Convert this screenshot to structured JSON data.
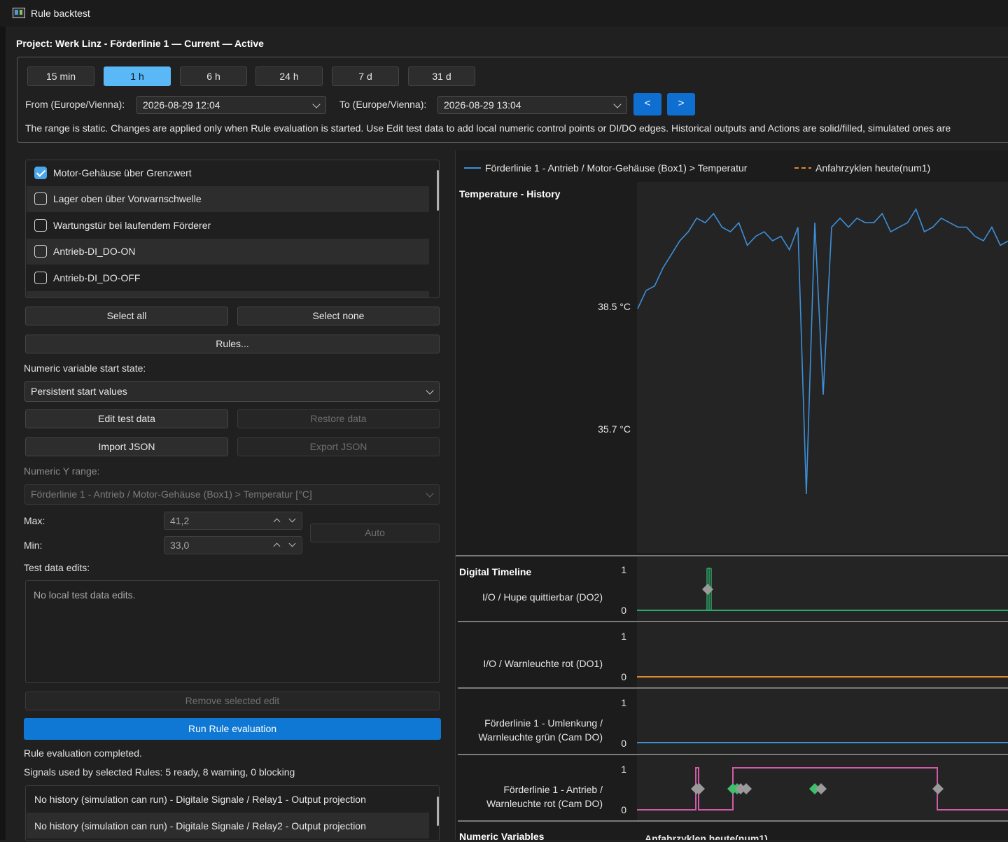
{
  "window": {
    "title": "Rule backtest"
  },
  "project": {
    "title": "Project: Werk Linz - Förderlinie 1 — Current — Active"
  },
  "range": {
    "presets": [
      "15 min",
      "1 h",
      "6 h",
      "24 h",
      "7 d",
      "31 d"
    ],
    "active_preset": "1 h",
    "from_label": "From (Europe/Vienna):",
    "from_value": "2026-08-29 12:04",
    "to_label": "To (Europe/Vienna):",
    "to_value": "2026-08-29 13:04",
    "prev_label": "<",
    "next_label": ">",
    "info": "The range is static. Changes are applied only when Rule evaluation is started. Use Edit test data to add local numeric control points or DI/DO edges. Historical outputs and Actions are solid/filled, simulated ones are"
  },
  "rules": {
    "items": [
      {
        "label": "Motor-Gehäuse über Grenzwert",
        "checked": true
      },
      {
        "label": "Lager oben über Vorwarnschwelle",
        "checked": false
      },
      {
        "label": "Wartungstür bei laufendem Förderer",
        "checked": false
      },
      {
        "label": "Antrieb-DI_DO-ON",
        "checked": false
      },
      {
        "label": "Antrieb-DI_DO-OFF",
        "checked": false
      }
    ],
    "select_all": "Select all",
    "select_none": "Select none",
    "rules_button": "Rules..."
  },
  "numeric_start": {
    "label": "Numeric variable start state:",
    "value": "Persistent start values"
  },
  "test_data": {
    "edit": "Edit test data",
    "restore": "Restore data",
    "import": "Import JSON",
    "export": "Export JSON"
  },
  "y_range": {
    "label": "Numeric Y range:",
    "variable": "Förderlinie 1 - Antrieb / Motor-Gehäuse (Box1) > Temperatur [°C]",
    "max_label": "Max:",
    "max_value": "41,2",
    "min_label": "Min:",
    "min_value": "33,0",
    "auto": "Auto"
  },
  "edits": {
    "label": "Test data edits:",
    "empty": "No local test data edits.",
    "remove": "Remove selected edit"
  },
  "run": {
    "button": "Run Rule evaluation",
    "status": "Rule evaluation completed.",
    "signals_summary": "Signals used by selected Rules: 5 ready, 8 warning, 0 blocking"
  },
  "signals": {
    "items": [
      "No history (simulation can run) - Digitale Signale / Relay1 - Output projection",
      "No history (simulation can run) - Digitale Signale / Relay2 - Output projection"
    ]
  },
  "chart_data": {
    "type": "line",
    "legend": [
      {
        "name": "Förderlinie 1 - Antrieb / Motor-Gehäuse (Box1) > Temperatur",
        "style": "solid",
        "color": "#3d8fd9"
      },
      {
        "name": "Anfahrzyklen heute(num1)",
        "style": "dashed",
        "color": "#e08a2a"
      }
    ],
    "title": "Temperature - History",
    "y_ticks": [
      "38.5 °C",
      "35.7 °C"
    ],
    "ylim": [
      33.0,
      41.2
    ],
    "temperature_series": [
      38.4,
      38.8,
      38.9,
      39.3,
      39.6,
      39.9,
      40.1,
      40.4,
      40.3,
      40.5,
      40.2,
      40.1,
      40.3,
      39.8,
      40.0,
      40.1,
      39.9,
      40.0,
      39.7,
      40.2,
      34.3,
      40.3,
      36.5,
      40.2,
      40.4,
      40.2,
      40.4,
      40.3,
      40.3,
      40.5,
      40.1,
      40.2,
      40.3,
      40.6,
      40.1,
      40.2,
      40.4,
      40.3,
      40.2,
      40.2,
      40.0,
      39.9,
      40.2,
      39.8,
      39.9
    ],
    "digital_title": "Digital Timeline",
    "digital_tracks": [
      {
        "label_lines": [
          "I/O / Hupe quittierbar (DO2)"
        ],
        "high": "1",
        "low": "0",
        "color": "#2ea86a"
      },
      {
        "label_lines": [
          "I/O / Warnleuchte rot (DO1)"
        ],
        "high": "1",
        "low": "0",
        "color": "#e08a2a"
      },
      {
        "label_lines": [
          "Förderlinie 1 - Umlenkung /",
          "Warnleuchte grün (Cam DO)"
        ],
        "high": "1",
        "low": "0",
        "color": "#3d8fd9"
      },
      {
        "label_lines": [
          "Förderlinie 1 - Antrieb /",
          "Warnleuchte rot (Cam DO)"
        ],
        "high": "1",
        "low": "0",
        "color": "#d25aa8"
      }
    ],
    "numeric_title": "Numeric Variables",
    "numeric_subtitle": "Anfahrzyklen heute(num1)"
  }
}
